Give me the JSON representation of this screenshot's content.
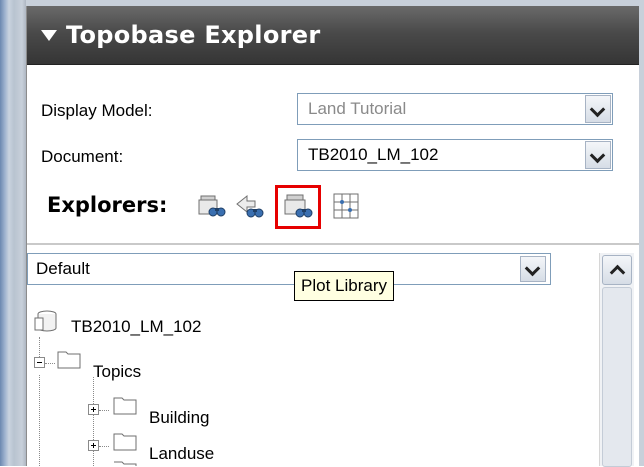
{
  "panel": {
    "title": "Topobase Explorer"
  },
  "display_model": {
    "label": "Display Model:",
    "value": "Land Tutorial"
  },
  "document": {
    "label": "Document:",
    "value": "TB2010_LM_102"
  },
  "explorers": {
    "label": "Explorers:",
    "icons": [
      "feature-explorer-icon",
      "sync-explorer-icon",
      "plot-library-icon",
      "grid-explorer-icon"
    ],
    "highlight_color": "#e60000"
  },
  "filter": {
    "value": "Default"
  },
  "tooltip": {
    "text": "Plot Library"
  },
  "tree": {
    "root": "TB2010_LM_102",
    "topics": "Topics",
    "items": [
      "Building",
      "Landuse"
    ]
  }
}
